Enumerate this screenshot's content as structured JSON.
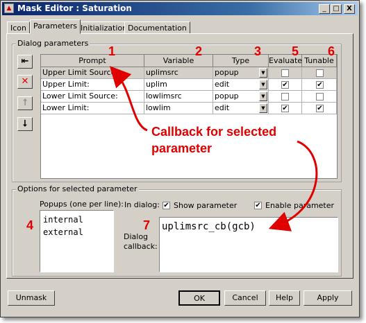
{
  "window": {
    "title": "Mask Editor : Saturation",
    "controls": [
      "_",
      "□",
      "X"
    ]
  },
  "tabs": [
    "Icon",
    "Parameters",
    "Initialization",
    "Documentation"
  ],
  "dialog_params": {
    "group_label": "Dialog parameters",
    "headers": [
      "Prompt",
      "Variable",
      "Type",
      "Evaluate",
      "Tunable"
    ],
    "rows": [
      {
        "prompt": "Upper Limit Source:",
        "variable": "uplimsrc",
        "type": "popup",
        "evaluate": false,
        "tunable": false,
        "selected": true
      },
      {
        "prompt": "Upper Limit:",
        "variable": "uplim",
        "type": "edit",
        "evaluate": true,
        "tunable": true,
        "selected": false
      },
      {
        "prompt": "Lower Limit Source:",
        "variable": "lowlimsrc",
        "type": "popup",
        "evaluate": false,
        "tunable": false,
        "selected": false
      },
      {
        "prompt": "Lower Limit:",
        "variable": "lowlim",
        "type": "edit",
        "evaluate": true,
        "tunable": true,
        "selected": false
      }
    ]
  },
  "annotations": {
    "n1": "1",
    "n2": "2",
    "n3": "3",
    "n4": "4",
    "n5": "5",
    "n6": "6",
    "n7": "7",
    "callout_line1": "Callback for selected",
    "callout_line2": "parameter"
  },
  "options": {
    "group_label": "Options for selected parameter",
    "popups_label": "Popups (one per line):",
    "popups": [
      "internal",
      "external"
    ],
    "in_dialog_label": "In dialog:",
    "show_parameter": {
      "label": "Show parameter",
      "checked": true
    },
    "enable_parameter": {
      "label": "Enable parameter",
      "checked": true
    },
    "callback_label_1": "Dialog",
    "callback_label_2": "callback:",
    "callback_value": "uplimsrc_cb(gcb)"
  },
  "buttons": {
    "unmask": "Unmask",
    "ok": "OK",
    "cancel": "Cancel",
    "help": "Help",
    "apply": "Apply"
  },
  "colors": {
    "annotation": "#e00000",
    "titlebar": "#0a246a"
  }
}
